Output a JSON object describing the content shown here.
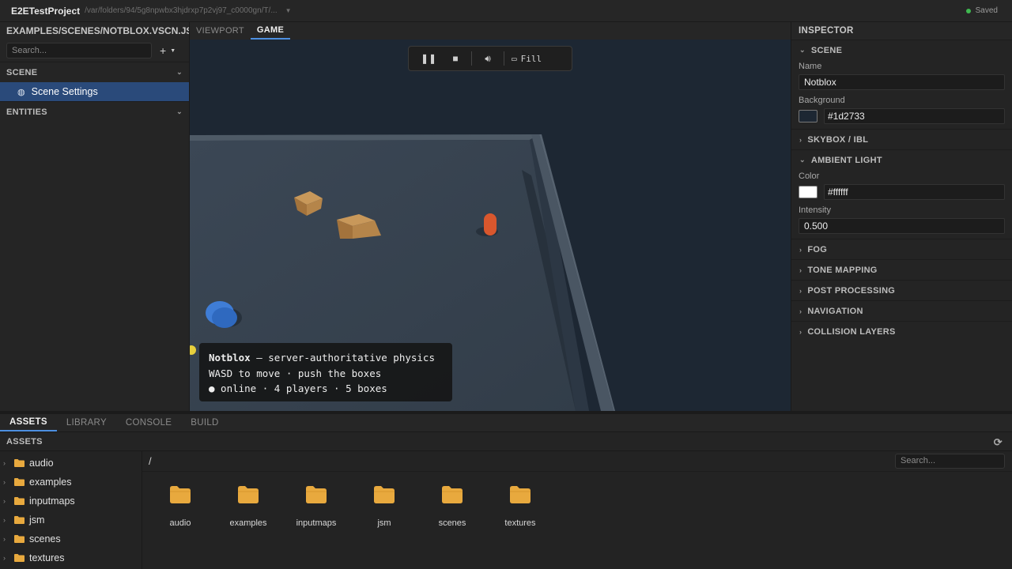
{
  "titlebar": {
    "project": "E2ETestProject",
    "path": "/var/folders/94/5g8npwbx3hjdrxp7p2vj97_c0000gn/T/...",
    "status": "Saved",
    "status_color": "#3fb950"
  },
  "left_panel": {
    "file_tab": "EXAMPLES/SCENES/NOTBLOX.VSCN.JSON",
    "search_placeholder": "Search...",
    "add_icon": "plus-icon",
    "scene_section": "SCENE",
    "scene_item": "Scene Settings",
    "scene_item_icon": "globe-icon",
    "entities_section": "ENTITIES"
  },
  "center_tabs": [
    {
      "label": "VIEWPORT",
      "active": false
    },
    {
      "label": "GAME",
      "active": true
    }
  ],
  "game_toolbar": {
    "pause_icon": "pause-icon",
    "stop_icon": "stop-icon",
    "volume_icon": "volume-icon",
    "fill_icon": "monitor-icon",
    "fill_label": "Fill"
  },
  "hud": {
    "title": "Notblox",
    "subtitle": " — server-authoritative physics",
    "line2": "WASD to move · push the boxes",
    "line3": "● online · 4 players · 5 boxes"
  },
  "inspector": {
    "title": "INSPECTOR",
    "scene_section": "SCENE",
    "name_label": "Name",
    "name_value": "Notblox",
    "background_label": "Background",
    "background_value": "#1d2733",
    "skybox_section": "SKYBOX / IBL",
    "ambient_section": "AMBIENT LIGHT",
    "color_label": "Color",
    "color_value": "#ffffff",
    "intensity_label": "Intensity",
    "intensity_value": "0.500",
    "collapsed_sections": [
      "FOG",
      "TONE MAPPING",
      "POST PROCESSING",
      "NAVIGATION",
      "COLLISION LAYERS"
    ]
  },
  "bottom_tabs": [
    {
      "label": "ASSETS",
      "active": true
    },
    {
      "label": "LIBRARY",
      "active": false
    },
    {
      "label": "CONSOLE",
      "active": false
    },
    {
      "label": "BUILD",
      "active": false
    }
  ],
  "assets": {
    "header": "ASSETS",
    "refresh_icon": "refresh-icon",
    "path": "/",
    "search_placeholder": "Search...",
    "tree": [
      "audio",
      "examples",
      "inputmaps",
      "jsm",
      "scenes",
      "textures"
    ],
    "grid": [
      "audio",
      "examples",
      "inputmaps",
      "jsm",
      "scenes",
      "textures"
    ],
    "folder_color": "#e8a93e"
  },
  "colors": {
    "accent": "#4d8fe0",
    "selection": "#2a4a7a"
  }
}
